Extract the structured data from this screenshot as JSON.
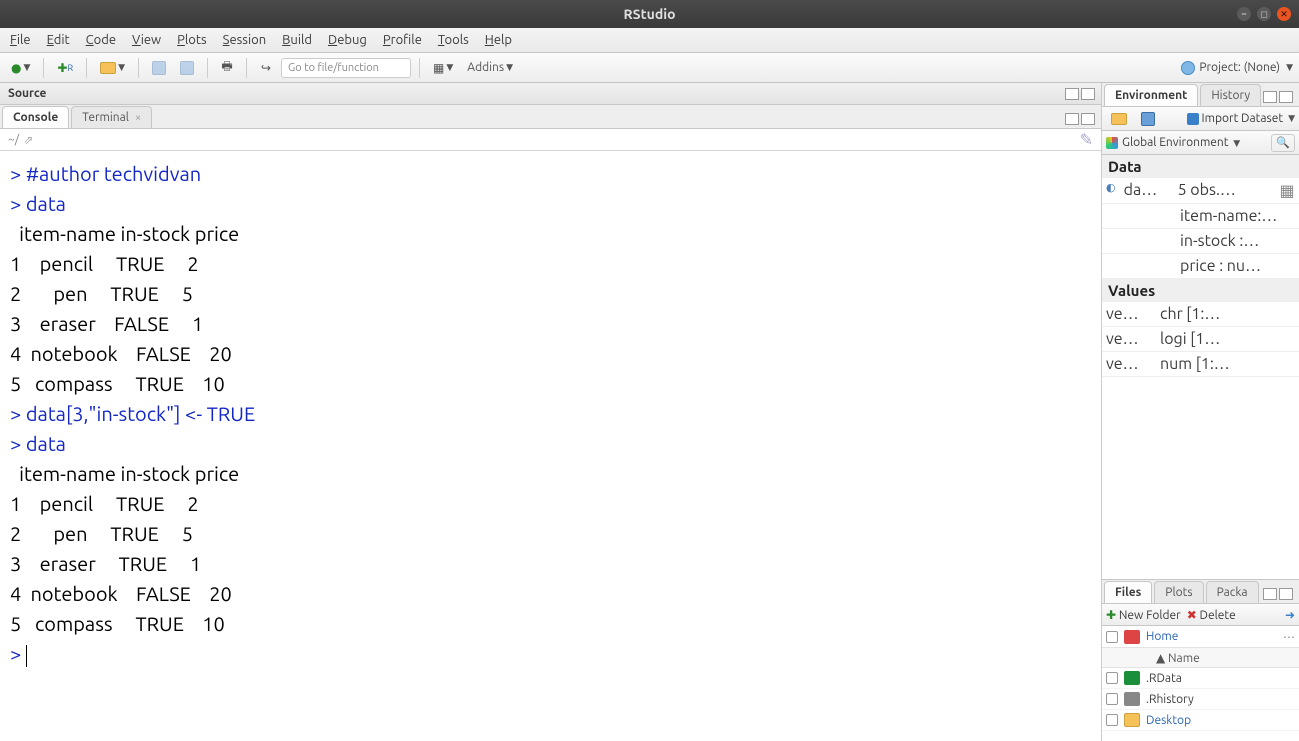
{
  "title": "RStudio",
  "menubar": [
    "File",
    "Edit",
    "Code",
    "View",
    "Plots",
    "Session",
    "Build",
    "Debug",
    "Profile",
    "Tools",
    "Help"
  ],
  "toolbar": {
    "goto_placeholder": "Go to file/function",
    "addins_label": "Addins",
    "project_label": "Project: (None)"
  },
  "left": {
    "source_title": "Source",
    "tabs": {
      "console": "Console",
      "terminal": "Terminal"
    },
    "prompt_path": "~/",
    "console_lines": [
      {
        "t": "cmd",
        "text": "> #author techvidvan"
      },
      {
        "t": "cmd",
        "text": "> data"
      },
      {
        "t": "out",
        "text": "  item-name in-stock price"
      },
      {
        "t": "out",
        "text": "1    pencil     TRUE     2"
      },
      {
        "t": "out",
        "text": "2       pen     TRUE     5"
      },
      {
        "t": "out",
        "text": "3    eraser    FALSE     1"
      },
      {
        "t": "out",
        "text": "4  notebook    FALSE    20"
      },
      {
        "t": "out",
        "text": "5   compass     TRUE    10"
      },
      {
        "t": "cmd",
        "text": "> data[3,\"in-stock\"] <- TRUE"
      },
      {
        "t": "cmd",
        "text": "> data"
      },
      {
        "t": "out",
        "text": "  item-name in-stock price"
      },
      {
        "t": "out",
        "text": "1    pencil     TRUE     2"
      },
      {
        "t": "out",
        "text": "2       pen     TRUE     5"
      },
      {
        "t": "out",
        "text": "3    eraser     TRUE     1"
      },
      {
        "t": "out",
        "text": "4  notebook    FALSE    20"
      },
      {
        "t": "out",
        "text": "5   compass     TRUE    10"
      },
      {
        "t": "prompt",
        "text": "> "
      }
    ]
  },
  "env": {
    "tabs": {
      "environment": "Environment",
      "history": "History"
    },
    "import_label": "Import Dataset",
    "scope_label": "Global Environment",
    "sections": {
      "data": "Data",
      "data_rows": [
        {
          "name": "da…",
          "val": "5 obs.…",
          "grid": true,
          "expand": true
        },
        {
          "name": "",
          "val": "item-name:…",
          "indent": true
        },
        {
          "name": "",
          "val": "in-stock :…",
          "indent": true
        },
        {
          "name": "",
          "val": "price : nu…",
          "indent": true
        }
      ],
      "values": "Values",
      "value_rows": [
        {
          "name": "ve…",
          "val": "chr [1:…"
        },
        {
          "name": "ve…",
          "val": "logi [1…"
        },
        {
          "name": "ve…",
          "val": "num [1:…"
        }
      ]
    }
  },
  "files": {
    "tabs": {
      "files": "Files",
      "plots": "Plots",
      "packages": "Packa"
    },
    "new_folder": "New Folder",
    "delete": "Delete",
    "home": "Home",
    "name_header": "Name",
    "rows": [
      {
        "icon": "rdata",
        "name": ".RData"
      },
      {
        "icon": "rhist",
        "name": ".Rhistory"
      },
      {
        "icon": "folder",
        "name": "Desktop"
      }
    ]
  }
}
